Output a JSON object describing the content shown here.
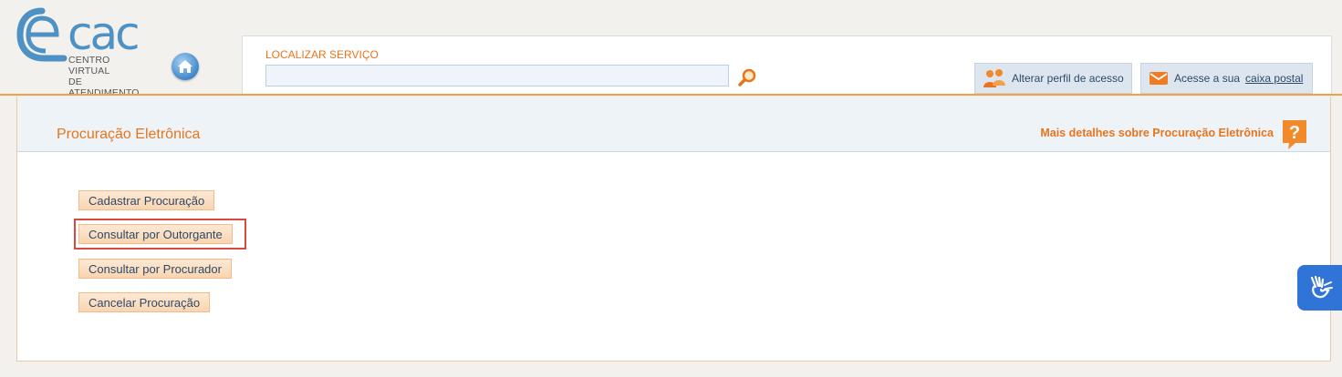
{
  "logo": {
    "word": "cac",
    "subtitle_line1": "CENTRO VIRTUAL",
    "subtitle_line2": "DE ATENDIMENTO"
  },
  "search": {
    "label": "LOCALIZAR SERVIÇO",
    "value": "",
    "placeholder": ""
  },
  "header_buttons": {
    "profile_label": "Alterar perfil de acesso",
    "mail_prefix": "Acesse a sua",
    "mail_link": "caixa postal"
  },
  "panel": {
    "title": "Procuração Eletrônica",
    "more_link": "Mais detalhes sobre Procuração Eletrônica"
  },
  "actions": [
    {
      "label": "Cadastrar Procuração"
    },
    {
      "label": "Consultar por Outorgante"
    },
    {
      "label": "Consultar por Procurador"
    },
    {
      "label": "Cancelar Procuração"
    }
  ],
  "highlighted_action": "Consultar por Outorgante",
  "colors": {
    "accent": "#e8741c",
    "link": "#2d4a6a",
    "logo_blue": "#4e91c4",
    "highlight": "#d9493d",
    "accessibility_blue": "#2f74d6"
  },
  "icons": {
    "home": "home-icon",
    "search": "magnifier-icon",
    "profile": "users-icon",
    "mail": "envelope-icon",
    "help": "question-icon",
    "accessibility": "sign-language-icon"
  }
}
